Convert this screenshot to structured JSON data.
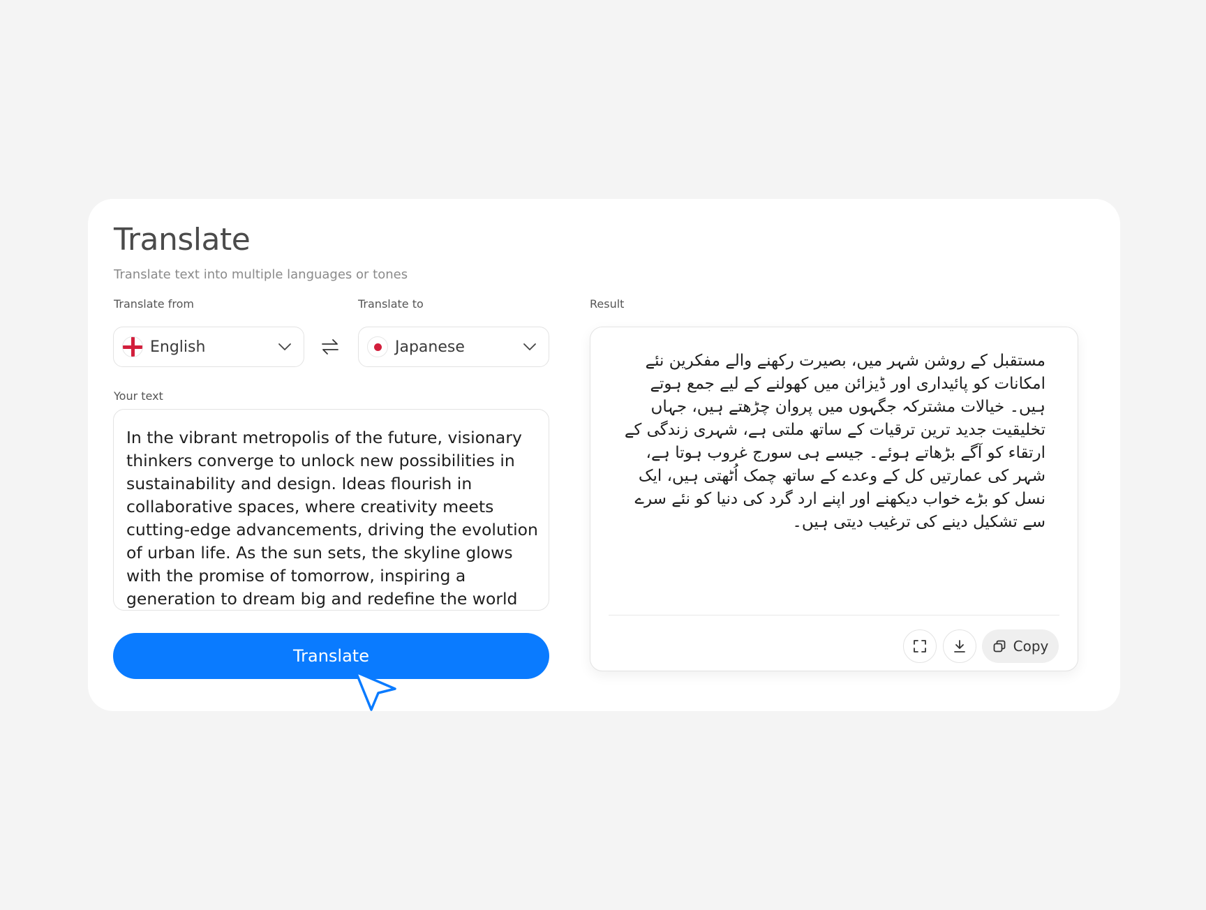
{
  "header": {
    "title": "Translate",
    "subtitle": "Translate text into multiple languages or tones"
  },
  "from": {
    "label": "Translate from",
    "language": "English",
    "flag": "england-flag-icon"
  },
  "to": {
    "label": "Translate to",
    "language": "Japanese",
    "flag": "japan-flag-icon"
  },
  "input": {
    "label": "Your text",
    "value": "In the vibrant metropolis of the future, visionary thinkers converge to unlock new possibilities in sustainability and design. Ideas flourish in collaborative spaces, where creativity meets cutting-edge advancements, driving the evolution of urban life. As the sun sets, the skyline glows with the promise of tomorrow, inspiring a generation to dream big and redefine the world around them."
  },
  "actions": {
    "translate_label": "Translate"
  },
  "result": {
    "label": "Result",
    "text": "مستقبل کے روشن شہر میں، بصیرت رکھنے والے مفکرین نئے امکانات کو پائیداری اور ڈیزائن میں کھولنے کے لیے جمع ہوتے ہیں۔ خیالات مشترکہ جگہوں میں پروان چڑھتے ہیں، جہاں تخلیقیت جدید ترین ترقیات کے ساتھ ملتی ہے، شہری زندگی کے ارتقاء کو آگے بڑھاتے ہوئے۔ جیسے ہی سورج غروب ہوتا ہے، شہر کی عمارتیں کل کے وعدے کے ساتھ چمک اُٹھتی ہیں، ایک نسل کو بڑے خواب دیکھنے اور اپنے ارد گرد کی دنیا کو نئے سرے سے تشکیل دینے کی ترغیب دیتی ہیں۔",
    "copy_label": "Copy"
  },
  "colors": {
    "accent": "#0a7bff",
    "background": "#f4f4f4",
    "card": "#ffffff",
    "flag_red": "#d21f3c"
  }
}
